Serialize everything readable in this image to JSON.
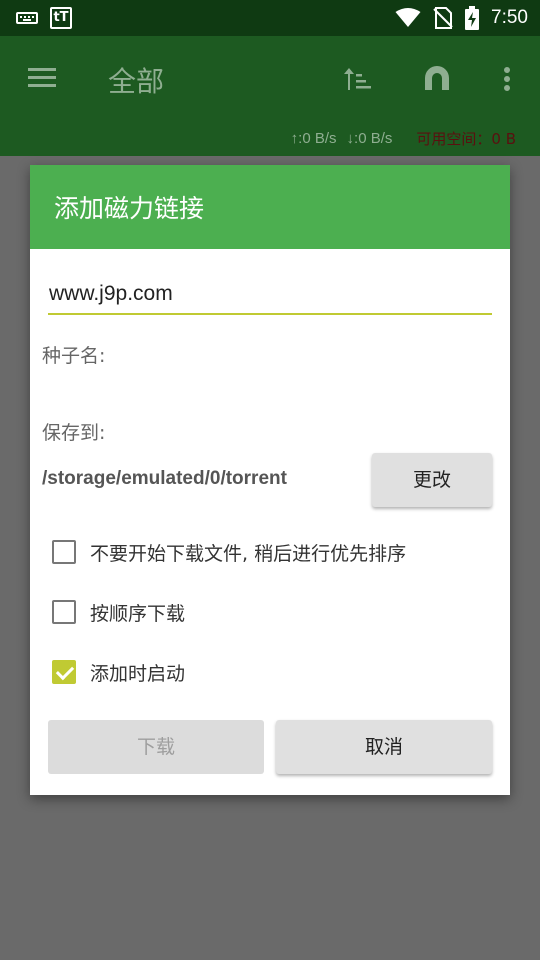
{
  "status_bar": {
    "time": "7:50",
    "tt_icon_text": "tT",
    "icons": [
      "keyboard-icon",
      "tt-app-icon",
      "wifi-icon",
      "no-sim-icon",
      "battery-charging-icon"
    ]
  },
  "app_bar": {
    "title": "全部",
    "upload_speed": "↑:0 B/s",
    "download_speed": "↓:0 B/s",
    "free_space": "可用空间：0 B",
    "icons": [
      "menu-icon",
      "sort-icon",
      "magnet-icon",
      "more-vert-icon"
    ]
  },
  "dialog": {
    "title": "添加磁力链接",
    "url_value": "www.j9p.com",
    "torrent_name_label": "种子名:",
    "save_to_label": "保存到:",
    "save_path": "/storage/emulated/0/torrent",
    "change_button": "更改",
    "options": [
      {
        "label": "不要开始下载文件, 稍后进行优先排序",
        "checked": false
      },
      {
        "label": "按顺序下载",
        "checked": false
      },
      {
        "label": "添加时启动",
        "checked": true
      }
    ],
    "download_button": "下载",
    "cancel_button": "取消"
  },
  "colors": {
    "status_bar": "#0f3a12",
    "app_bar": "#1d5a21",
    "dialog_header": "#4caf50",
    "accent": "#c0ca33",
    "scrim": "#6a6a6a"
  }
}
